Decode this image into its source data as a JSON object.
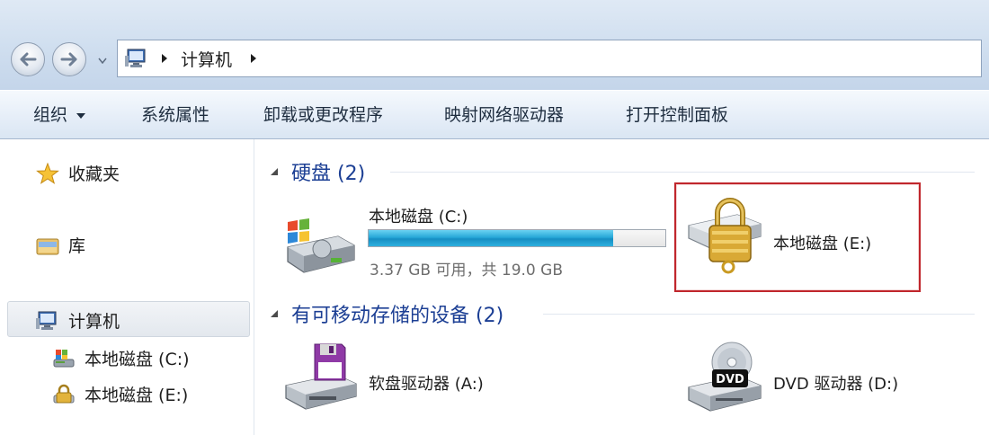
{
  "address_bar": {
    "breadcrumb": "计算机"
  },
  "toolbar": {
    "organize_label": "组织",
    "system_properties_label": "系统属性",
    "uninstall_label": "卸载或更改程序",
    "map_drive_label": "映射网络驱动器",
    "control_panel_label": "打开控制面板"
  },
  "sidebar": {
    "items": [
      {
        "label": "收藏夹",
        "icon": "star-icon"
      },
      {
        "label": "库",
        "icon": "library-icon"
      },
      {
        "label": "计算机",
        "icon": "computer-icon"
      },
      {
        "label": "本地磁盘 (C:)",
        "icon": "system-drive-icon"
      },
      {
        "label": "本地磁盘 (E:)",
        "icon": "locked-drive-icon"
      }
    ]
  },
  "groups": {
    "hard_disks": {
      "title": "硬盘 (2)",
      "drives": [
        {
          "name": "本地磁盘 (C:)",
          "free_text": "3.37 GB 可用，共 19.0 GB",
          "used_fraction": 0.823,
          "icon": "windows-drive-icon"
        },
        {
          "name": "本地磁盘 (E:)",
          "icon": "padlock-drive-icon"
        }
      ]
    },
    "removable": {
      "title": "有可移动存储的设备 (2)",
      "drives": [
        {
          "name": "软盘驱动器 (A:)",
          "icon": "floppy-drive-icon"
        },
        {
          "name": "DVD 驱动器 (D:)",
          "icon": "dvd-drive-icon",
          "badge": "DVD"
        }
      ]
    }
  },
  "colors": {
    "group_header": "#1c3f94",
    "highlight_border": "#c0262c",
    "usage_bar": "#27a8d8"
  }
}
